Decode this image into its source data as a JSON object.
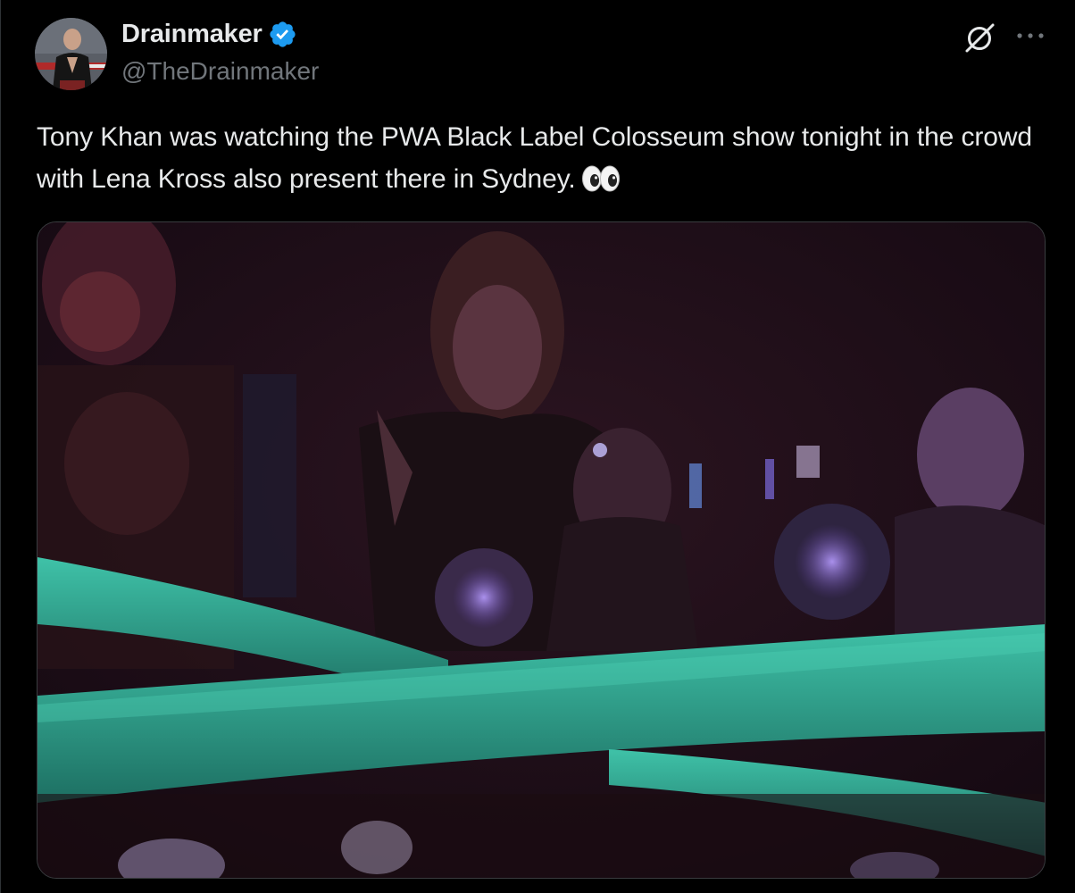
{
  "tweet": {
    "author": {
      "display_name": "Drainmaker",
      "handle": "@TheDrainmaker",
      "verified": true
    },
    "text": "Tony Khan was watching the PWA Black Label Colosseum show tonight in the crowd with Lena Kross also present there in Sydney.",
    "emoji": "👀",
    "icons": [
      "avatar",
      "verified-badge-icon",
      "grok-icon",
      "more-options-icon",
      "eyes-emoji-icon"
    ]
  },
  "colors": {
    "background": "#000000",
    "text": "#e7e9ea",
    "secondary_text": "#71767b",
    "verified_blue": "#1d9bf0",
    "rope_teal": "#2aa58f"
  }
}
